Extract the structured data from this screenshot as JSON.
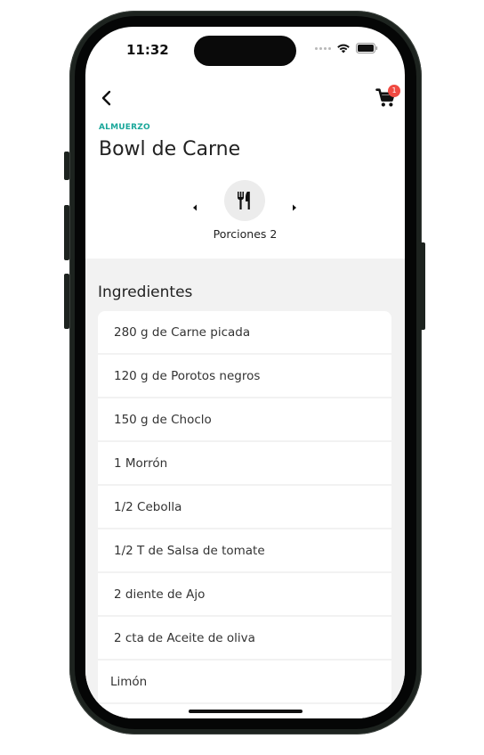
{
  "status": {
    "time": "11:32"
  },
  "header": {
    "cart_count": "1"
  },
  "recipe": {
    "category": "ALMUERZO",
    "title": "Bowl de Carne"
  },
  "portions": {
    "label": "Porciones 2"
  },
  "ingredients": {
    "heading": "Ingredientes",
    "items": [
      "280 g de Carne picada",
      "120 g de Porotos negros",
      "150 g de Choclo",
      "1 Morrón",
      "1/2 Cebolla",
      "1/2 T de Salsa de tomate",
      "2 diente de Ajo",
      "2 cta de Aceite de oliva",
      "Limón"
    ]
  },
  "colors": {
    "accent": "#1aa79a",
    "badge": "#f04a42",
    "section_bg": "#f2f2f2"
  }
}
